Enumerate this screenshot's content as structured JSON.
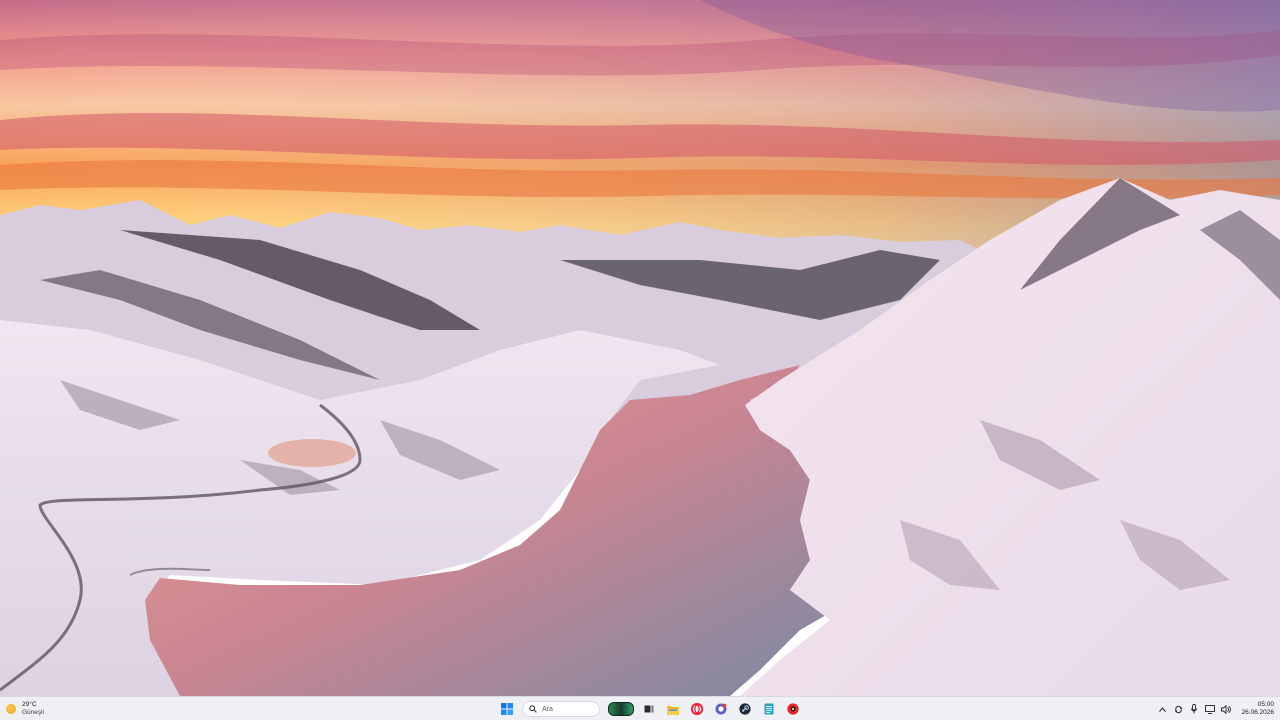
{
  "taskbar": {
    "weather": {
      "temperature": "29°C",
      "condition": "Güneşli",
      "icon": "sun-icon"
    },
    "search": {
      "placeholder": "Ara"
    },
    "pinned_apps": [
      {
        "name": "start-icon"
      },
      {
        "name": "copilot-icon"
      },
      {
        "name": "task-view-icon"
      },
      {
        "name": "file-explorer-icon"
      },
      {
        "name": "opera-icon"
      },
      {
        "name": "chat-app-icon"
      },
      {
        "name": "steam-icon"
      },
      {
        "name": "notepad-icon"
      },
      {
        "name": "red-app-icon"
      }
    ],
    "tray": {
      "icons": [
        "chevron-up-icon",
        "sync-icon",
        "microphone-icon",
        "monitor-icon",
        "speaker-icon"
      ],
      "time": "05:00",
      "date": "26.06.2026"
    }
  },
  "colors": {
    "taskbar_bg": "#eef0f4",
    "accent": "#0078d4"
  }
}
